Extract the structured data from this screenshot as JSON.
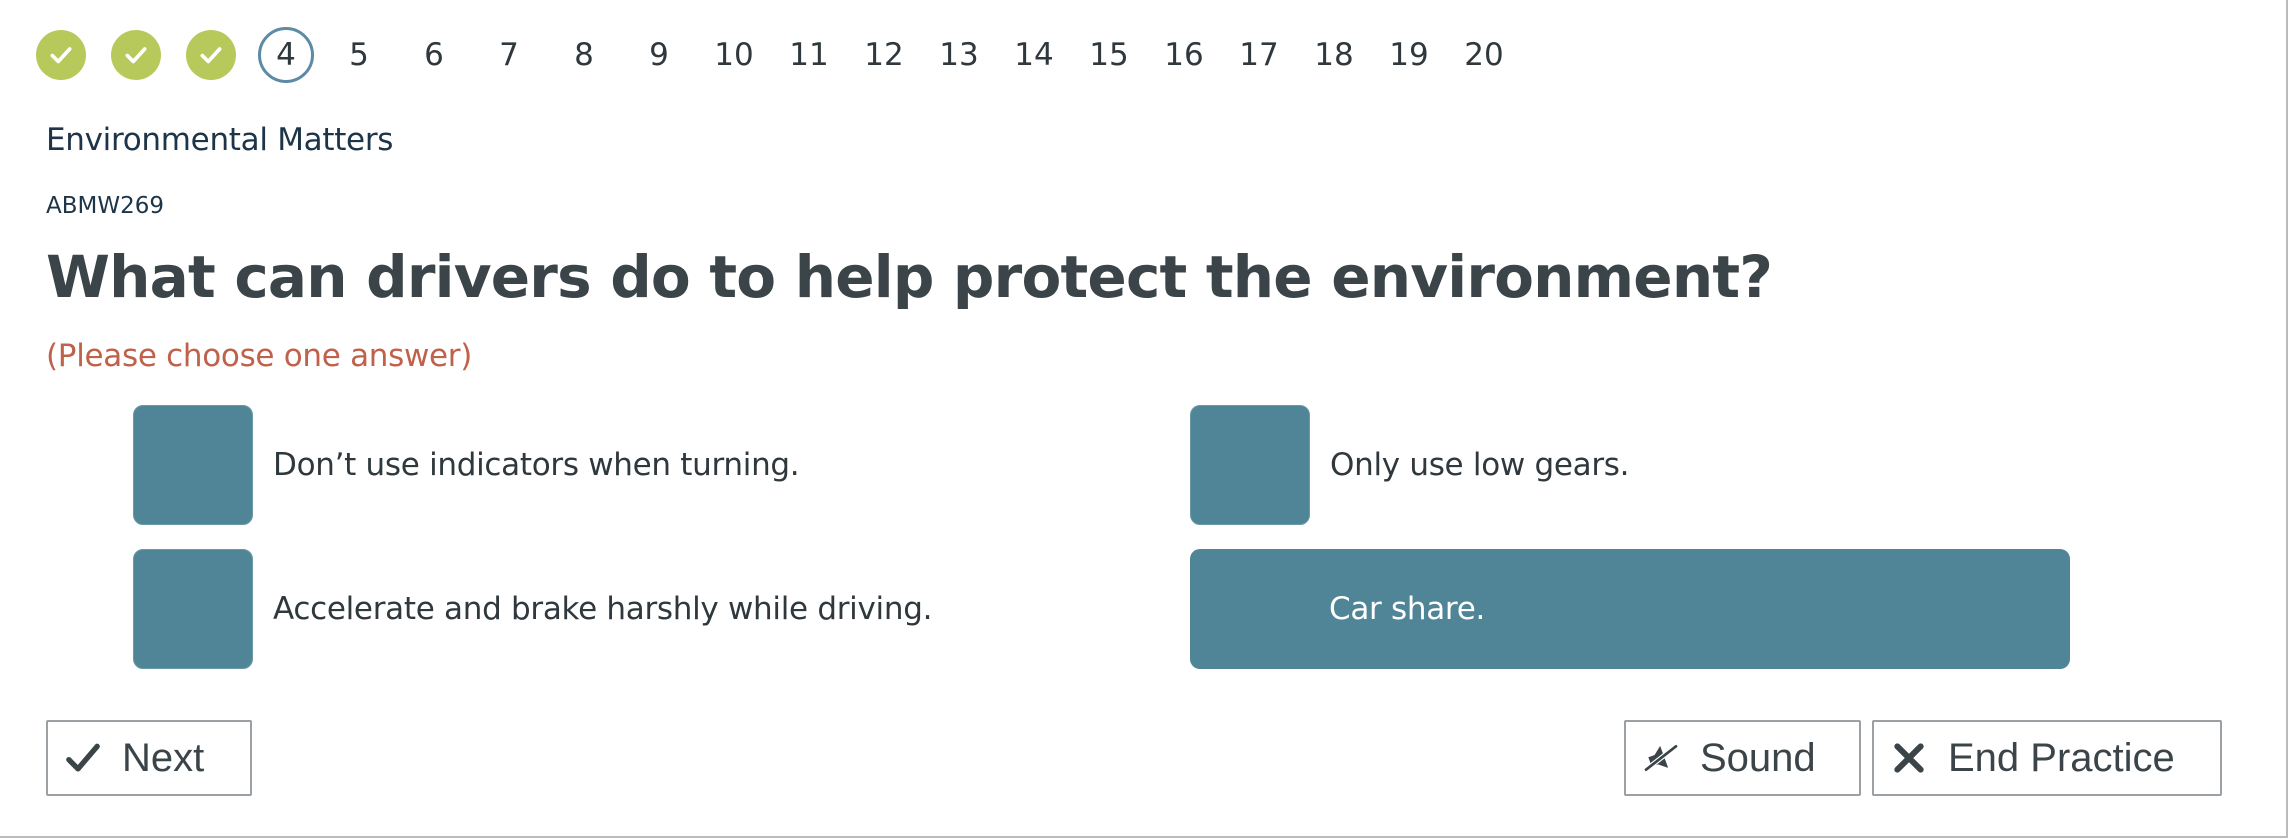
{
  "progress": {
    "steps": [
      "1",
      "2",
      "3",
      "4",
      "5",
      "6",
      "7",
      "8",
      "9",
      "10",
      "11",
      "12",
      "13",
      "14",
      "15",
      "16",
      "17",
      "18",
      "19",
      "20"
    ],
    "completed_count": 3,
    "current": "4",
    "completed_icon": "check-icon",
    "completed_color": "#b7c95b",
    "current_ring_color": "#5d8aa5"
  },
  "question": {
    "category": "Environmental Matters",
    "id": "ABMW269",
    "text": "What can drivers do to help protect the environment?",
    "instruction": "(Please choose one answer)",
    "instruction_color": "#c0614b"
  },
  "answers": [
    {
      "label": "Don’t use indicators when turning.",
      "selected": false
    },
    {
      "label": "Only use low gears.",
      "selected": false
    },
    {
      "label": "Accelerate and brake harshly while driving.",
      "selected": false
    },
    {
      "label": "Car share.",
      "selected": true
    }
  ],
  "answer_color": "#4f8596",
  "buttons": {
    "next": {
      "label": "Next",
      "icon": "check-icon"
    },
    "sound": {
      "label": "Sound",
      "icon": "speaker-muted-icon"
    },
    "end": {
      "label": "End Practice",
      "icon": "close-icon"
    }
  }
}
